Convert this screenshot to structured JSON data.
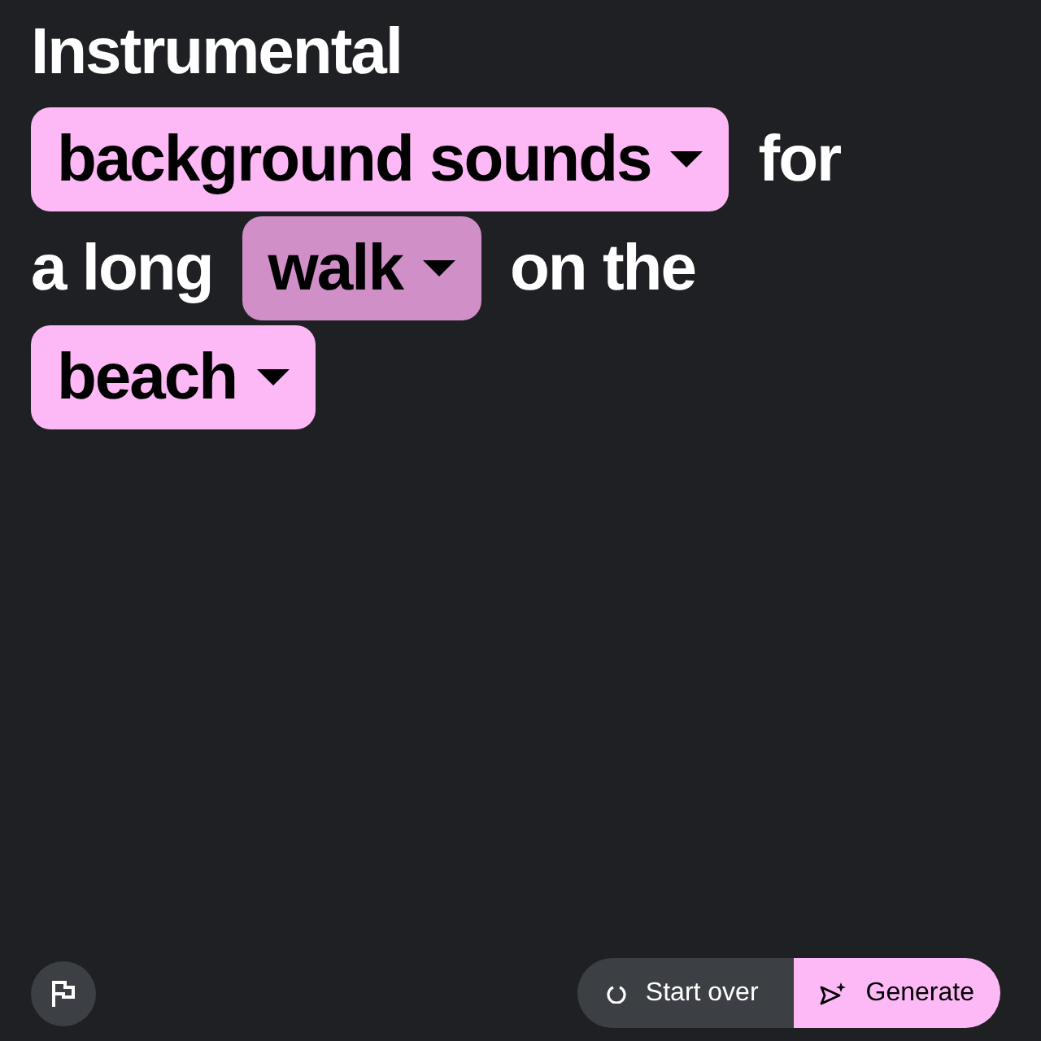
{
  "prompt_lines": [
    [
      {
        "kind": "text",
        "text": "Instrumental"
      }
    ],
    [
      {
        "kind": "dropdown",
        "text": "background sounds",
        "selected": false
      },
      {
        "kind": "text",
        "text": "for"
      }
    ],
    [
      {
        "kind": "text",
        "text": "a long"
      },
      {
        "kind": "dropdown",
        "text": "walk",
        "selected": true
      },
      {
        "kind": "text",
        "text": "on the"
      }
    ],
    [
      {
        "kind": "dropdown",
        "text": "beach",
        "selected": false
      }
    ]
  ],
  "footer": {
    "start_over": "Start over",
    "generate": "Generate"
  }
}
